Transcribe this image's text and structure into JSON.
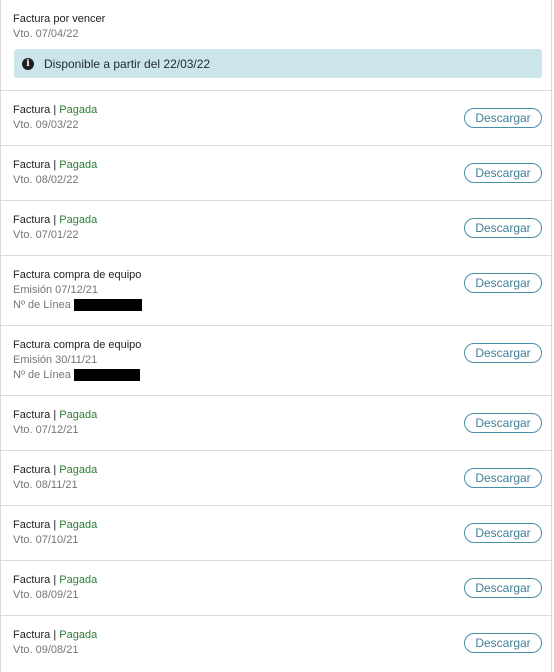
{
  "pending": {
    "title": "Factura por vencer",
    "due": "Vto. 07/04/22",
    "info": "Disponible a partir del 22/03/22",
    "info_icon": "info-icon"
  },
  "download_label": "Descargar",
  "separator": " | ",
  "colors": {
    "paid": "#2e7d32",
    "button": "#3f7f98",
    "info_bg": "#cce5eb"
  },
  "invoices": [
    {
      "title": "Factura",
      "status": "Pagada",
      "date": "Vto. 09/03/22"
    },
    {
      "title": "Factura",
      "status": "Pagada",
      "date": "Vto. 08/02/22"
    },
    {
      "title": "Factura",
      "status": "Pagada",
      "date": "Vto. 07/01/22"
    },
    {
      "title": "Factura compra de equipo",
      "status": "",
      "date": "Emisión 07/12/21",
      "line_label": "Nº de Línea"
    },
    {
      "title": "Factura compra de equipo",
      "status": "",
      "date": "Emisión 30/11/21",
      "line_label": "Nº de Línea"
    },
    {
      "title": "Factura",
      "status": "Pagada",
      "date": "Vto. 07/12/21"
    },
    {
      "title": "Factura",
      "status": "Pagada",
      "date": "Vto. 08/11/21"
    },
    {
      "title": "Factura",
      "status": "Pagada",
      "date": "Vto. 07/10/21"
    },
    {
      "title": "Factura",
      "status": "Pagada",
      "date": "Vto. 08/09/21"
    },
    {
      "title": "Factura",
      "status": "Pagada",
      "date": "Vto. 09/08/21"
    }
  ]
}
